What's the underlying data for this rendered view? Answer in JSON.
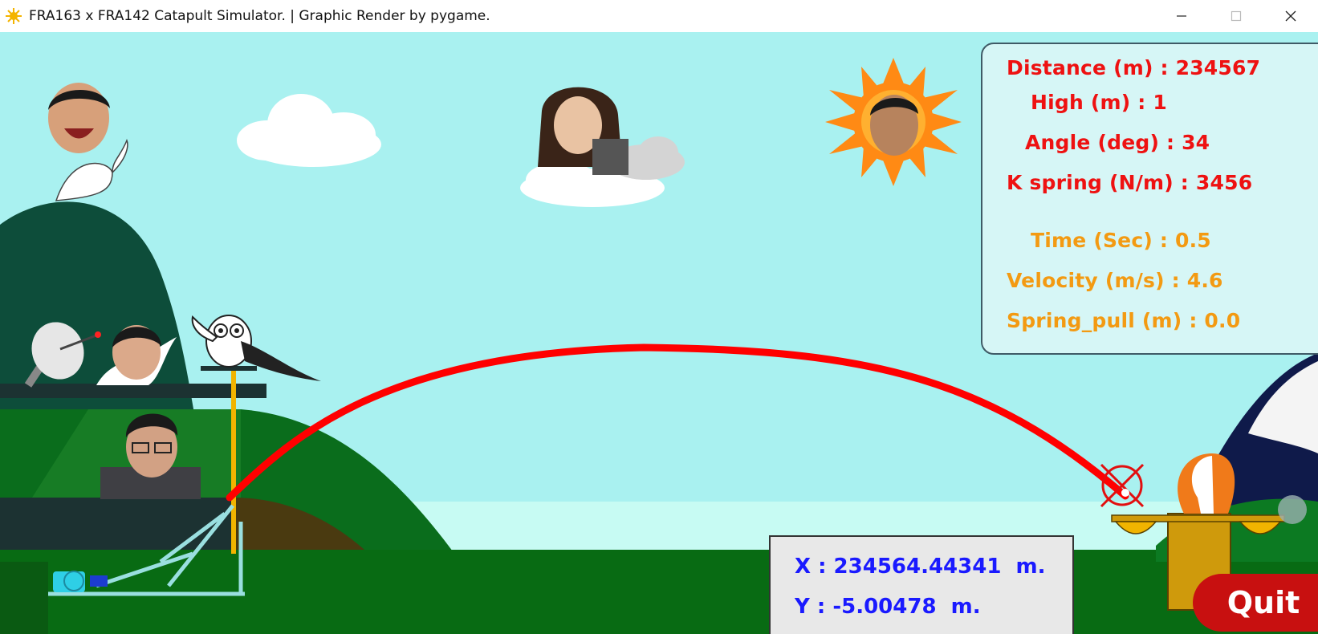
{
  "window": {
    "title": "FRA163 x FRA142 Catapult Simulator. | Graphic Render by pygame.",
    "minimize_icon": "minimize-icon",
    "maximize_icon": "maximize-icon",
    "close_icon": "close-icon"
  },
  "info_panel": {
    "distance": "Distance (m) : 234567",
    "high": "High (m) : 1",
    "angle": "Angle (deg) : 34",
    "k_spring": "K spring (N/m) : 3456",
    "time": "Time (Sec) : 0.5",
    "velocity": "Velocity (m/s) : 4.6",
    "spring_pull": "Spring_pull (m) : 0.0"
  },
  "coordinates": {
    "x": "X : 234564.44341  m.",
    "y": "Y : -5.00478  m."
  },
  "quit_button": {
    "label": "Quit"
  },
  "colors": {
    "sky": "#a9f1f0",
    "trajectory": "#ff0000",
    "result_text": "#ee1111",
    "status_text": "#f39a12",
    "coordinate_text": "#1a1aff",
    "quit": "#c81010"
  }
}
